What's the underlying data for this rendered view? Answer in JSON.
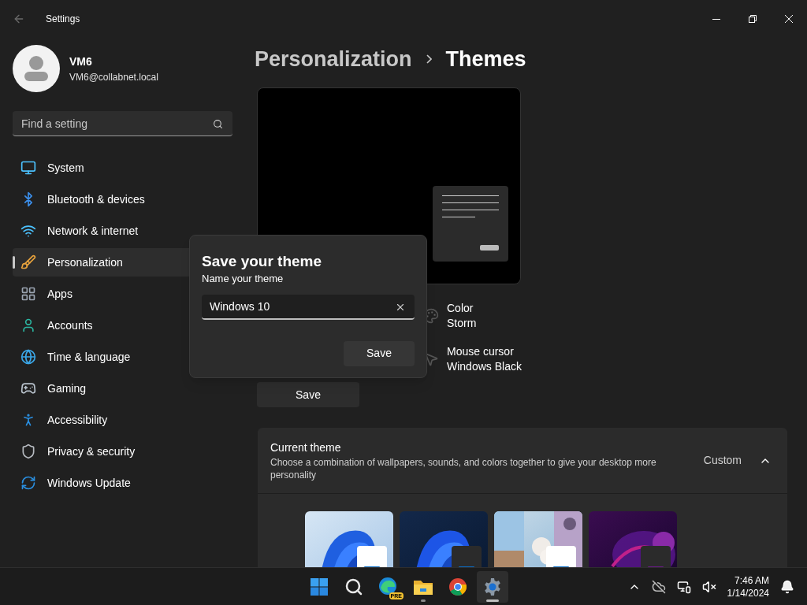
{
  "window": {
    "title": "Settings"
  },
  "profile": {
    "name": "VM6",
    "email": "VM6@collabnet.local"
  },
  "search": {
    "placeholder": "Find a setting"
  },
  "nav": [
    {
      "label": "System",
      "kind": "system",
      "selected": false
    },
    {
      "label": "Bluetooth & devices",
      "kind": "bluetooth",
      "selected": false
    },
    {
      "label": "Network & internet",
      "kind": "network",
      "selected": false
    },
    {
      "label": "Personalization",
      "kind": "personalization",
      "selected": true
    },
    {
      "label": "Apps",
      "kind": "apps",
      "selected": false
    },
    {
      "label": "Accounts",
      "kind": "accounts",
      "selected": false
    },
    {
      "label": "Time & language",
      "kind": "time",
      "selected": false
    },
    {
      "label": "Gaming",
      "kind": "gaming",
      "selected": false
    },
    {
      "label": "Accessibility",
      "kind": "accessibility",
      "selected": false
    },
    {
      "label": "Privacy & security",
      "kind": "privacy",
      "selected": false
    },
    {
      "label": "Windows Update",
      "kind": "update",
      "selected": false
    }
  ],
  "breadcrumb": {
    "parent": "Personalization",
    "current": "Themes"
  },
  "preview_rows": [
    {
      "kind": "color",
      "title": "Color",
      "value": "Storm"
    },
    {
      "kind": "cursor",
      "title": "Mouse cursor",
      "value": "Windows Black"
    }
  ],
  "save_button": "Save",
  "current_theme": {
    "title": "Current theme",
    "description": "Choose a combination of wallpapers, sounds, and colors together to give your desktop more personality",
    "value": "Custom",
    "expanded": true
  },
  "dialog": {
    "title": "Save your theme",
    "label": "Name your theme",
    "value": "Windows 10",
    "button": "Save"
  },
  "taskbar": {
    "apps": [
      {
        "kind": "start",
        "running": false,
        "active": false
      },
      {
        "kind": "search",
        "running": false,
        "active": false
      },
      {
        "kind": "edge",
        "badge": "PRE",
        "running": false,
        "active": false
      },
      {
        "kind": "explorer",
        "running": true,
        "active": false
      },
      {
        "kind": "chrome",
        "running": false,
        "active": false
      },
      {
        "kind": "settings",
        "running": true,
        "active": true
      }
    ],
    "time": "7:46 AM",
    "date": "1/14/2024"
  }
}
